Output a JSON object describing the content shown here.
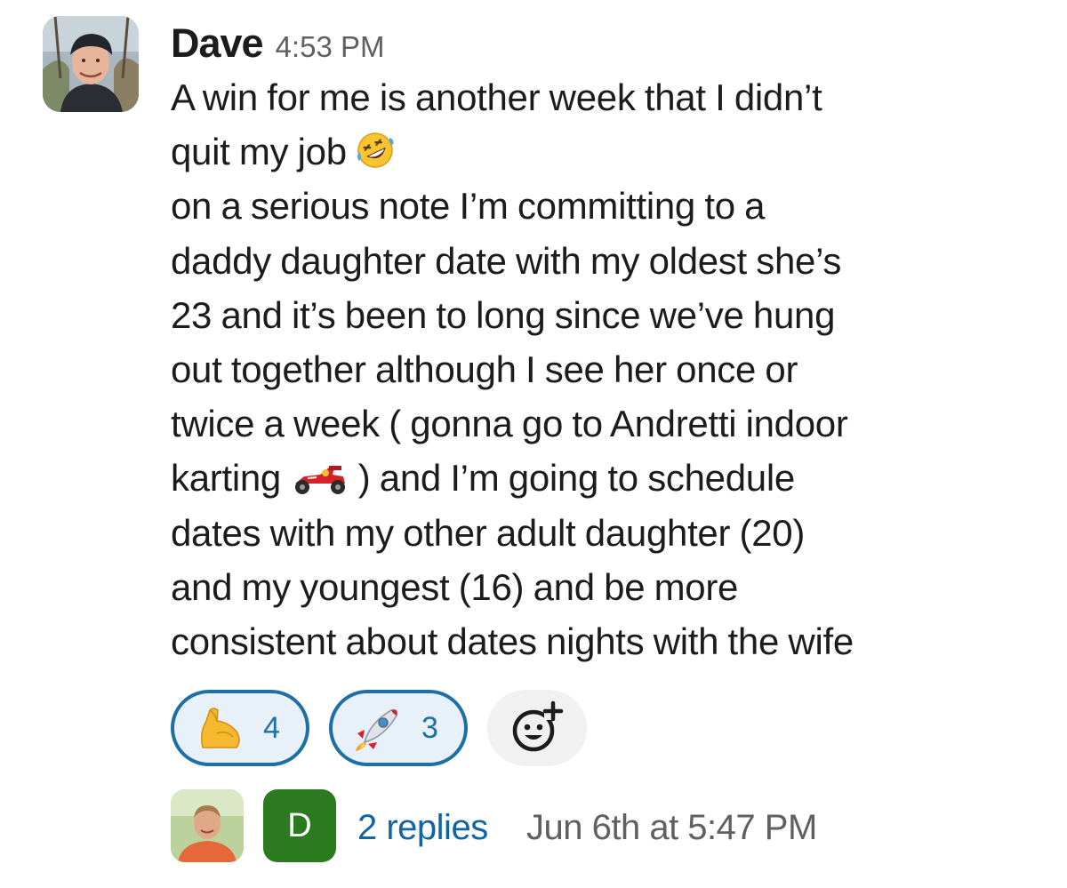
{
  "message": {
    "author": "Dave",
    "timestamp": "4:53 PM",
    "lines": [
      "A win for me is another week that I didn’t",
      "quit my job",
      "on a serious note I’m committing to a",
      "daddy daughter date with my oldest she’s",
      "23 and it’s been to long since we’ve hung",
      "out together although I see her once or",
      "twice a week ( gonna go to Andretti indoor",
      "karting",
      "dates with my other adult daughter (20)",
      "and my youngest (16)  and be more",
      "consistent about dates nights with the wife"
    ],
    "karting_line_suffix": ") and I’m going to schedule",
    "inline_emojis": {
      "after_line_2": "rolling-on-floor-laughing-emoji",
      "after_line_8": "racing-car-emoji"
    }
  },
  "reactions": [
    {
      "emoji": "flexed-biceps-emoji",
      "count": "4"
    },
    {
      "emoji": "rocket-emoji",
      "count": "3"
    }
  ],
  "add_reaction_icon": "add-reaction-icon",
  "thread": {
    "replies": "2 replies",
    "last_reply": "Jun 6th at 5:47 PM",
    "reply_avatar_2_initial": "D"
  },
  "colors": {
    "link": "#1264a3",
    "reaction_border": "#1d6fa5",
    "reaction_bg": "#e8f1f9",
    "avatar_d_bg": "#2b7a1f",
    "meta_gray": "#616061"
  }
}
